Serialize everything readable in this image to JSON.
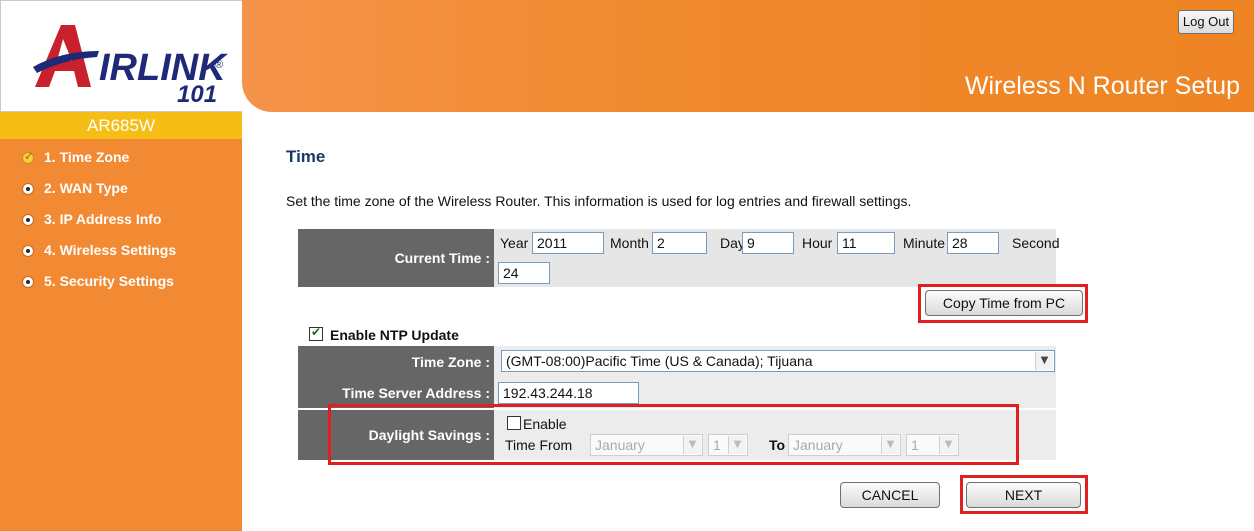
{
  "brand": {
    "logo_text": "IRLINK",
    "logo_reg": "®",
    "logo_num": "101",
    "model": "AR685W"
  },
  "header": {
    "title": "Wireless N Router Setup",
    "logout_label": "Log Out"
  },
  "nav": {
    "items": [
      {
        "label": "1. Time Zone",
        "active": true
      },
      {
        "label": "2. WAN Type",
        "active": false
      },
      {
        "label": "3. IP Address Info",
        "active": false
      },
      {
        "label": "4. Wireless Settings",
        "active": false
      },
      {
        "label": "5. Security Settings",
        "active": false
      }
    ]
  },
  "main": {
    "title": "Time",
    "description": "Set the time zone of the Wireless Router. This information is used for log entries and firewall settings."
  },
  "current_time": {
    "label": "Current Time :",
    "year_label": "Year",
    "year": "2011",
    "month_label": "Month",
    "month": "2",
    "day_label": "Day",
    "day": "9",
    "hour_label": "Hour",
    "hour": "11",
    "minute_label": "Minute",
    "minute": "28",
    "second_label": "Second",
    "second": "24",
    "copy_button": "Copy Time from PC"
  },
  "ntp": {
    "enable_label": "Enable NTP Update",
    "enabled": true,
    "timezone_label": "Time Zone :",
    "timezone_value": "(GMT-08:00)Pacific Time (US & Canada); Tijuana",
    "server_label": "Time Server Address :",
    "server_value": "192.43.244.18"
  },
  "daylight": {
    "label": "Daylight Savings :",
    "enable_label": "Enable",
    "enabled": false,
    "time_from_label": "Time From",
    "from_month": "January",
    "from_day": "1",
    "to_label": "To",
    "to_month": "January",
    "to_day": "1"
  },
  "actions": {
    "cancel": "CANCEL",
    "next": "NEXT"
  },
  "colors": {
    "sidebar": "#f28a33",
    "model_bar": "#f6bd16",
    "label_cell": "#666666",
    "value_cell": "#ececec",
    "highlight": "#e02020",
    "title": "#1a3a66"
  }
}
